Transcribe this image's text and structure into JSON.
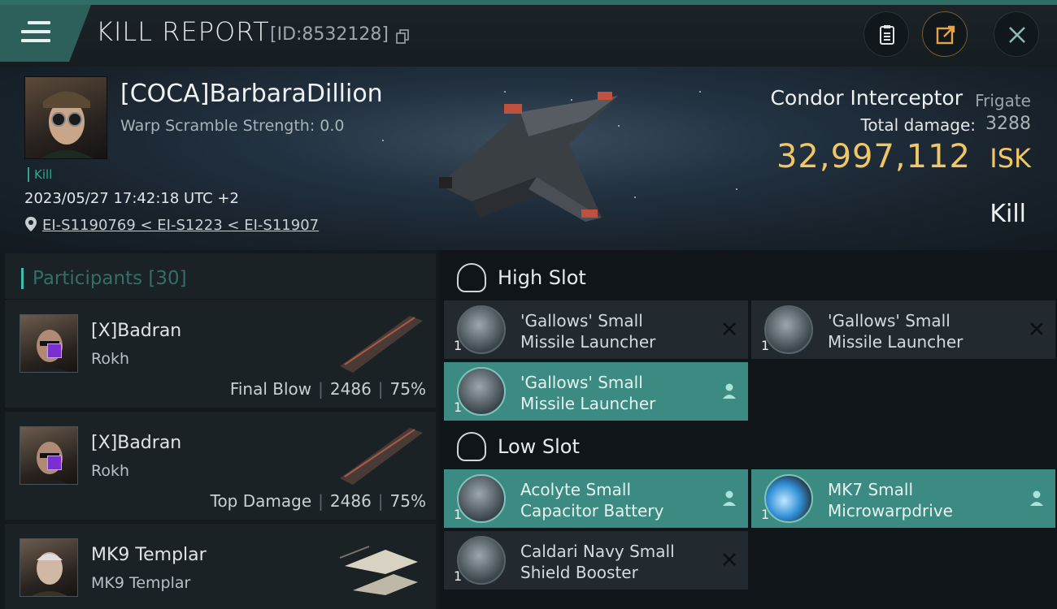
{
  "header": {
    "title": "KILL REPORT",
    "report_id": "[ID:8532128]",
    "icons": [
      "menu-icon",
      "copy-icon",
      "clipboard-icon",
      "share-icon",
      "close-icon"
    ]
  },
  "victim": {
    "name": "[COCA]BarbaraDillion",
    "warp_scramble": "Warp Scramble Strength: 0.0",
    "tag": "Kill",
    "datetime": "2023/05/27 17:42:18 UTC +2",
    "location": "EI-S1190769 < EI-S1223 < EI-S11907",
    "ship_name": "Condor Interceptor",
    "ship_class": "Frigate",
    "damage_label": "Total damage:",
    "damage_value": "3288",
    "isk_value": "32,997,112",
    "isk_unit": "ISK",
    "kill_type": "Kill"
  },
  "participants": {
    "title": "Participants",
    "count": "[30]",
    "items": [
      {
        "name": "[X]Badran",
        "ship": "Rokh",
        "role": "Final Blow",
        "damage": "2486",
        "percent": "75%"
      },
      {
        "name": "[X]Badran",
        "ship": "Rokh",
        "role": "Top Damage",
        "damage": "2486",
        "percent": "75%"
      },
      {
        "name": "MK9 Templar",
        "ship": "MK9 Templar",
        "role": "",
        "damage": "",
        "percent": ""
      }
    ]
  },
  "fitting": {
    "high_slot": {
      "title": "High Slot",
      "modules": [
        {
          "qty": "1",
          "name": "'Gallows' Small Missile Launcher",
          "state": "destroyed"
        },
        {
          "qty": "1",
          "name": "'Gallows' Small Missile Launcher",
          "state": "destroyed"
        },
        {
          "qty": "1",
          "name": "'Gallows' Small Missile Launcher",
          "state": "dropped"
        }
      ]
    },
    "low_slot": {
      "title": "Low Slot",
      "modules": [
        {
          "qty": "1",
          "name": "Acolyte Small Capacitor Battery",
          "state": "dropped"
        },
        {
          "qty": "1",
          "name": "MK7 Small Microwarpdrive",
          "state": "dropped"
        },
        {
          "qty": "1",
          "name": "Caldari Navy Small Shield Booster",
          "state": "destroyed"
        }
      ]
    }
  },
  "colors": {
    "accent": "#3b8b83",
    "isk": "#f0c667",
    "kill_tag": "#2ea58f"
  }
}
